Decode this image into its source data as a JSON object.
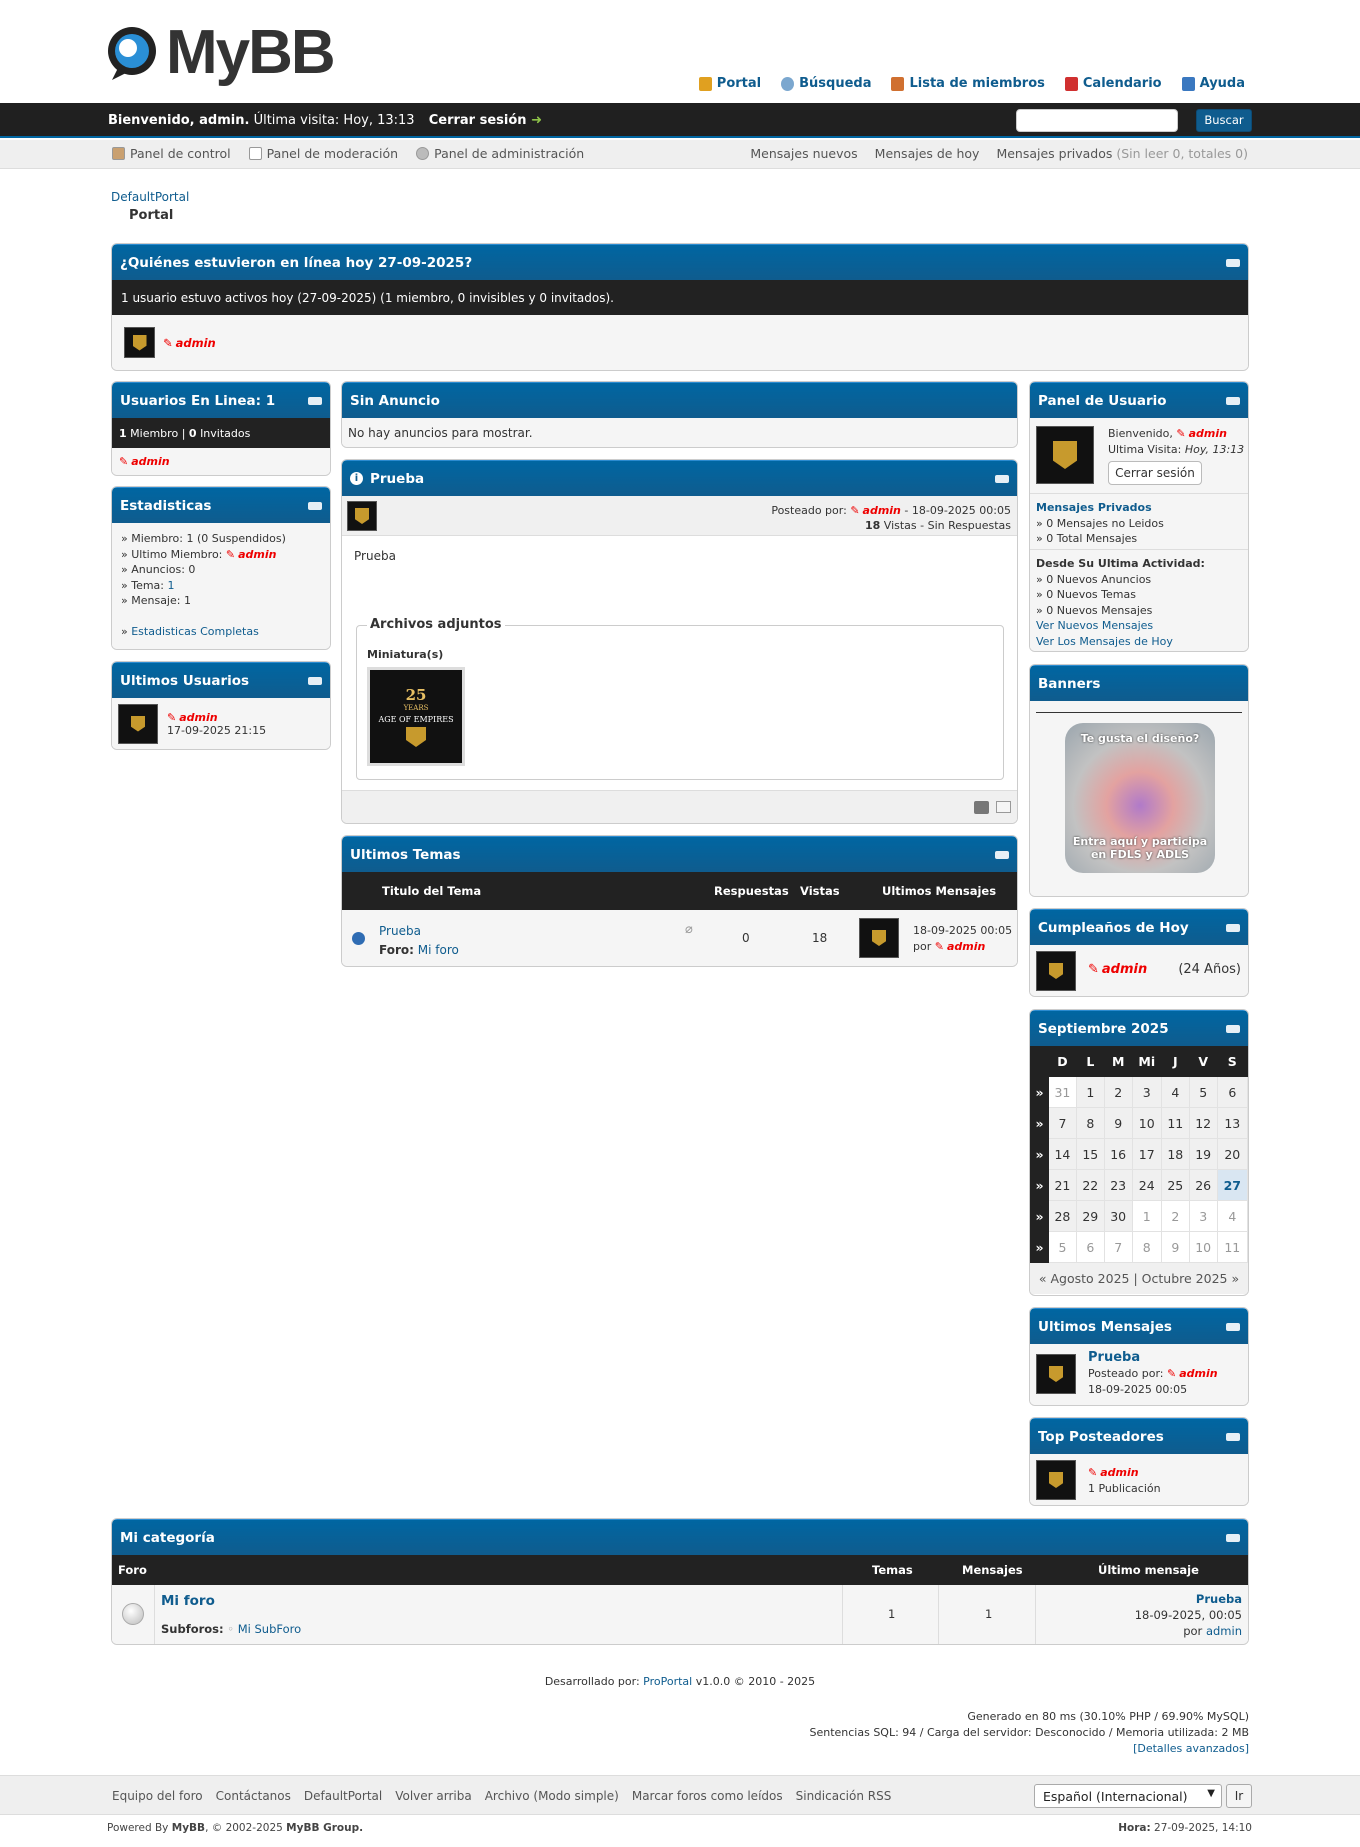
{
  "header": {
    "logo_text": "MyBB",
    "nav": [
      {
        "label": "Portal",
        "icon": "bell-icon",
        "color": "#e0a020"
      },
      {
        "label": "Búsqueda",
        "icon": "magnifier-icon",
        "color": "#7ba7cf"
      },
      {
        "label": "Lista de miembros",
        "icon": "members-icon",
        "color": "#d07030"
      },
      {
        "label": "Calendario",
        "icon": "calendar-icon",
        "color": "#d03030"
      },
      {
        "label": "Ayuda",
        "icon": "help-icon",
        "color": "#3a78c0"
      }
    ]
  },
  "panel": {
    "welcome_prefix": "Bienvenido, admin.",
    "last_visit": "Última visita: Hoy, 13:13",
    "logout": "Cerrar sesión",
    "arrow": "➜",
    "search_btn": "Buscar",
    "search_value": ""
  },
  "upper": {
    "left": [
      "Panel de control",
      "Panel de moderación",
      "Panel de administración"
    ],
    "right": [
      "Mensajes nuevos",
      "Mensajes de hoy",
      "Mensajes privados"
    ],
    "pm_count": "(Sin leer 0, totales 0)"
  },
  "breadcrumb": {
    "root": "DefaultPortal",
    "current": "Portal"
  },
  "online_today": {
    "title": "¿Quiénes estuvieron en línea hoy 27-09-2025?",
    "summary": "1 usuario estuvo activos hoy (27-09-2025) (1 miembro, 0 invisibles y 0 invitados).",
    "user": "admin"
  },
  "left": {
    "online": {
      "title": "Usuarios En Linea: 1",
      "members_n": "1",
      "members_l": "Miembro",
      "sep": "|",
      "guests_n": "0",
      "guests_l": "Invitados",
      "user": "admin"
    },
    "stats": {
      "title": "Estadisticas",
      "members": "» Miembro: 1 (0 Suspendidos)",
      "last_member_prefix": "» Ultimo Miembro:",
      "last_member": "admin",
      "threads": "» Anuncios: 0",
      "topics_prefix": "» Tema:",
      "topics": "1",
      "posts": "» Mensaje: 1",
      "full_prefix": "»",
      "full": "Estadisticas Completas"
    },
    "latest_users": {
      "title": "Ultimos Usuarios",
      "user": "admin",
      "date": "17-09-2025 21:15"
    }
  },
  "center": {
    "noann": {
      "title": "Sin Anuncio",
      "text": "No hay anuncios para mostrar."
    },
    "ann": {
      "title": "Prueba",
      "posted_by": "Posteado por:",
      "author": "admin",
      "date": "- 18-09-2025 00:05",
      "views_n": "18",
      "views_rest": "Vistas - Sin Respuestas",
      "body": "Prueba",
      "attach_title": "Archivos adjuntos",
      "thumb_label": "Miniatura(s)",
      "thumb_text1": "25",
      "thumb_text2": "YEARS",
      "thumb_text3": "AGE OF EMPIRES"
    },
    "latest_topics": {
      "title": "Ultimos Temas",
      "cols": [
        "Titulo del Tema",
        "Respuestas",
        "Vistas",
        "Ultimos Mensajes"
      ],
      "topic": "Prueba",
      "forum_label": "Foro:",
      "forum": "Mi foro",
      "replies": "0",
      "views": "18",
      "last_date": "18-09-2025 00:05",
      "last_by": "por",
      "last_user": "admin"
    }
  },
  "right": {
    "user_panel": {
      "title": "Panel de Usuario",
      "welcome": "Bienvenido,",
      "user": "admin",
      "last_visit_label": "Ultima Visita:",
      "last_visit": "Hoy, 13:13",
      "logout": "Cerrar sesión",
      "pm_title": "Mensajes Privados",
      "pm_unread": "» 0 Mensajes no Leidos",
      "pm_total": "» 0 Total Mensajes",
      "since_title": "Desde Su Ultima Actividad:",
      "since_ann": "» 0 Nuevos Anuncios",
      "since_topics": "» 0 Nuevos Temas",
      "since_posts": "» 0 Nuevos Mensajes",
      "view_new": "Ver Nuevos Mensajes",
      "view_today": "Ver Los Mensajes de Hoy"
    },
    "banners": {
      "title": "Banners",
      "line1": "Te gusta el diseño?",
      "line2": "Entra aquí y participa",
      "line3": "en FDLS y ADLS"
    },
    "birthdays": {
      "title": "Cumpleaños de Hoy",
      "user": "admin",
      "age": "(24 Años)"
    },
    "calendar": {
      "title": "Septiembre 2025",
      "days": [
        "D",
        "L",
        "M",
        "Mi",
        "J",
        "V",
        "S"
      ],
      "weeks": [
        [
          "31",
          "1",
          "2",
          "3",
          "4",
          "5",
          "6"
        ],
        [
          "7",
          "8",
          "9",
          "10",
          "11",
          "12",
          "13"
        ],
        [
          "14",
          "15",
          "16",
          "17",
          "18",
          "19",
          "20"
        ],
        [
          "21",
          "22",
          "23",
          "24",
          "25",
          "26",
          "27"
        ],
        [
          "28",
          "29",
          "30",
          "1",
          "2",
          "3",
          "4"
        ],
        [
          "5",
          "6",
          "7",
          "8",
          "9",
          "10",
          "11"
        ]
      ],
      "week_marker": "»",
      "prev": "« Agosto 2025",
      "sep": "|",
      "next": "Octubre 2025 »",
      "today": "27"
    },
    "latest_posts": {
      "title": "Ultimos Mensajes",
      "topic": "Prueba",
      "posted_by": "Posteado por:",
      "user": "admin",
      "date": "18-09-2025 00:05"
    },
    "top_posters": {
      "title": "Top Posteadores",
      "user": "admin",
      "count": "1 Publicación"
    }
  },
  "category": {
    "title": "Mi categoría",
    "cols": [
      "Foro",
      "Temas",
      "Mensajes",
      "Último mensaje"
    ],
    "forum": "Mi foro",
    "subforums_label": "Subforos:",
    "subforum": "Mi SubForo",
    "topics": "1",
    "posts": "1",
    "last_topic": "Prueba",
    "last_date": "18-09-2025, 00:05",
    "last_by": "por",
    "last_user": "admin"
  },
  "footer": {
    "dev_prefix": "Desarrollado por:",
    "dev_link": "ProPortal",
    "dev_rest": "v1.0.0 © 2010 - 2025",
    "generated": "Generado en 80 ms (30.10% PHP / 69.90% MySQL)",
    "sql": "Sentencias SQL: 94 / Carga del servidor: Desconocido / Memoria utilizada: 2 MB",
    "advanced": "[Detalles avanzados]",
    "links": [
      "Equipo del foro",
      "Contáctanos",
      "DefaultPortal",
      "Volver arriba",
      "Archivo (Modo simple)",
      "Marcar foros como leídos",
      "Sindicación RSS"
    ],
    "lang": "Español (Internacional)",
    "go": "Ir",
    "powered_prefix": "Powered By",
    "powered_mybb": "MyBB",
    "powered_mid": ", © 2002-2025",
    "powered_group": "MyBB Group.",
    "time_label": "Hora:",
    "time": "27-09-2025, 14:10"
  }
}
